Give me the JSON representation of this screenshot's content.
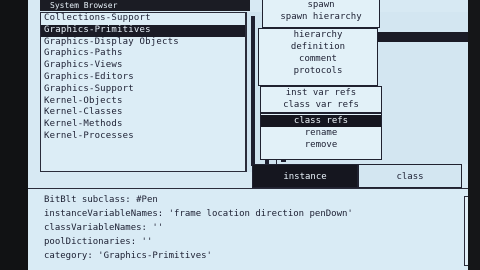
{
  "browser": {
    "title": "System Browser",
    "categories": [
      {
        "label": "Collections-Support",
        "selected": false
      },
      {
        "label": "Graphics-Primitives",
        "selected": true
      },
      {
        "label": "Graphics-Display Objects",
        "selected": false
      },
      {
        "label": "Graphics-Paths",
        "selected": false
      },
      {
        "label": "Graphics-Views",
        "selected": false
      },
      {
        "label": "Graphics-Editors",
        "selected": false
      },
      {
        "label": "Graphics-Support",
        "selected": false
      },
      {
        "label": "Kernel-Objects",
        "selected": false
      },
      {
        "label": "Kernel-Classes",
        "selected": false
      },
      {
        "label": "Kernel-Methods",
        "selected": false
      },
      {
        "label": "Kernel-Processes",
        "selected": false
      }
    ]
  },
  "menus": {
    "top": [
      "spawn",
      "spawn hierarchy"
    ],
    "main": [
      "hierarchy",
      "definition",
      "comment",
      "protocols"
    ],
    "sub": [
      {
        "label": "inst var refs",
        "selected": false
      },
      {
        "label": "class var refs",
        "selected": false
      },
      {
        "label": "class refs",
        "selected": true
      },
      {
        "label": "rename",
        "selected": false
      },
      {
        "label": "remove",
        "selected": false
      }
    ]
  },
  "toggle": {
    "instance_label": "instance",
    "class_label": "class"
  },
  "code": {
    "lines": [
      "BitBlt subclass: #Pen",
      "    instanceVariableNames: 'frame location direction penDown'",
      "    classVariableNames: ''",
      "    poolDictionaries: ''",
      "    category: 'Graphics-Primitives'"
    ]
  }
}
